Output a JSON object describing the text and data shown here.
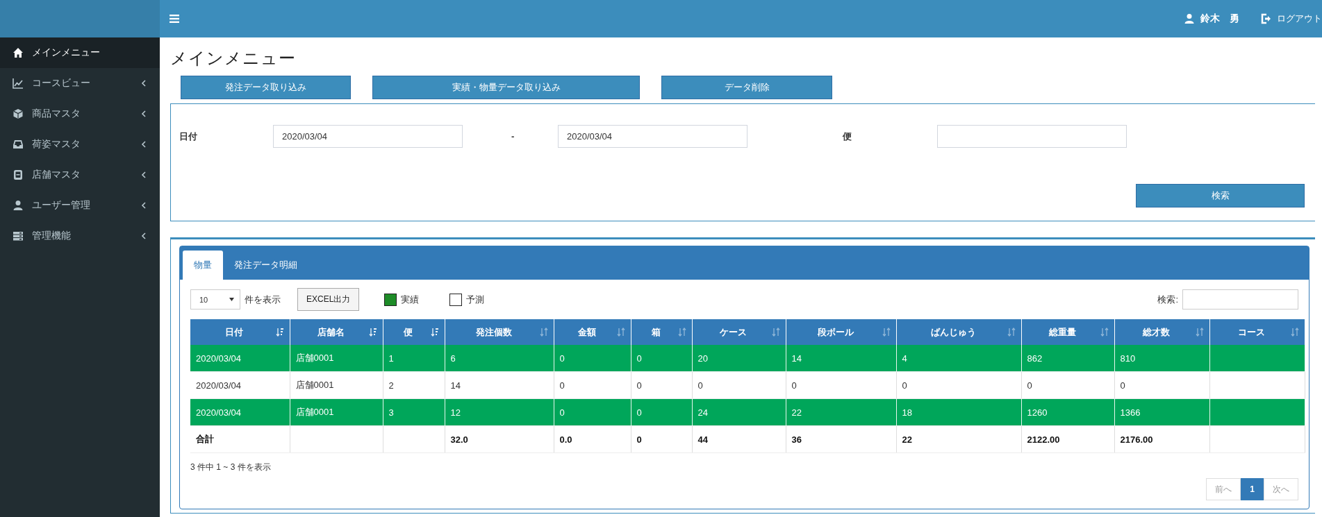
{
  "header": {
    "user_name": "鈴木　勇",
    "logout": "ログアウト"
  },
  "sidebar": {
    "items": [
      {
        "label": "メインメニュー",
        "selected": true,
        "has_submenu": false
      },
      {
        "label": "コースビュー",
        "selected": false,
        "has_submenu": true
      },
      {
        "label": "商品マスタ",
        "selected": false,
        "has_submenu": true
      },
      {
        "label": "荷姿マスタ",
        "selected": false,
        "has_submenu": true
      },
      {
        "label": "店舗マスタ",
        "selected": false,
        "has_submenu": true
      },
      {
        "label": "ユーザー管理",
        "selected": false,
        "has_submenu": true
      },
      {
        "label": "管理機能",
        "selected": false,
        "has_submenu": true
      }
    ]
  },
  "page_title": "メインメニュー",
  "action_buttons": [
    "発注データ取り込み",
    "実績・物量データ取り込み",
    "データ削除"
  ],
  "filter": {
    "date_label": "日付",
    "date_from": "2020/03/04",
    "separator": "-",
    "date_to": "2020/03/04",
    "trip_label": "便",
    "search_button": "検索"
  },
  "tabs": [
    {
      "label": "物量",
      "selected": true
    },
    {
      "label": "発注データ明細",
      "selected": false
    }
  ],
  "toolbar": {
    "page_length": "10",
    "page_length_label": "件を表示",
    "excel_button": "EXCEL出力",
    "search_label": "検索:"
  },
  "legend": [
    {
      "label": "実績",
      "color": "#1e8c28"
    },
    {
      "label": "予測",
      "color": "#ffffff"
    }
  ],
  "table": {
    "columns": [
      {
        "label": "日付",
        "sorted": true
      },
      {
        "label": "店舗名",
        "sorted": true
      },
      {
        "label": "便",
        "sorted": true
      },
      {
        "label": "発注個数",
        "sorted": false
      },
      {
        "label": "金額",
        "sorted": false
      },
      {
        "label": "箱",
        "sorted": false
      },
      {
        "label": "ケース",
        "sorted": false
      },
      {
        "label": "段ボール",
        "sorted": false
      },
      {
        "label": "ばんじゅう",
        "sorted": false
      },
      {
        "label": "総重量",
        "sorted": false
      },
      {
        "label": "総才数",
        "sorted": false
      },
      {
        "label": "コース",
        "sorted": false
      }
    ],
    "rows": [
      {
        "kind": "actual",
        "cells": [
          "2020/03/04",
          "店舗0001",
          "1",
          "6",
          "0",
          "0",
          "20",
          "14",
          "4",
          "862",
          "810",
          ""
        ]
      },
      {
        "kind": "forecast",
        "cells": [
          "2020/03/04",
          "店舗0001",
          "2",
          "14",
          "0",
          "0",
          "0",
          "0",
          "0",
          "0",
          "0",
          ""
        ]
      },
      {
        "kind": "actual",
        "cells": [
          "2020/03/04",
          "店舗0001",
          "3",
          "12",
          "0",
          "0",
          "24",
          "22",
          "18",
          "1260",
          "1366",
          ""
        ]
      },
      {
        "kind": "total",
        "cells": [
          "合計",
          "",
          "",
          "32.0",
          "0.0",
          "0",
          "44",
          "36",
          "22",
          "2122.00",
          "2176.00",
          ""
        ]
      }
    ]
  },
  "info": "3 件中 1 ~ 3 件を表示",
  "pagination": [
    {
      "label": "前へ",
      "selected": false,
      "disabled": true
    },
    {
      "label": "1",
      "selected": true,
      "disabled": false
    },
    {
      "label": "次へ",
      "selected": false,
      "disabled": true
    }
  ]
}
